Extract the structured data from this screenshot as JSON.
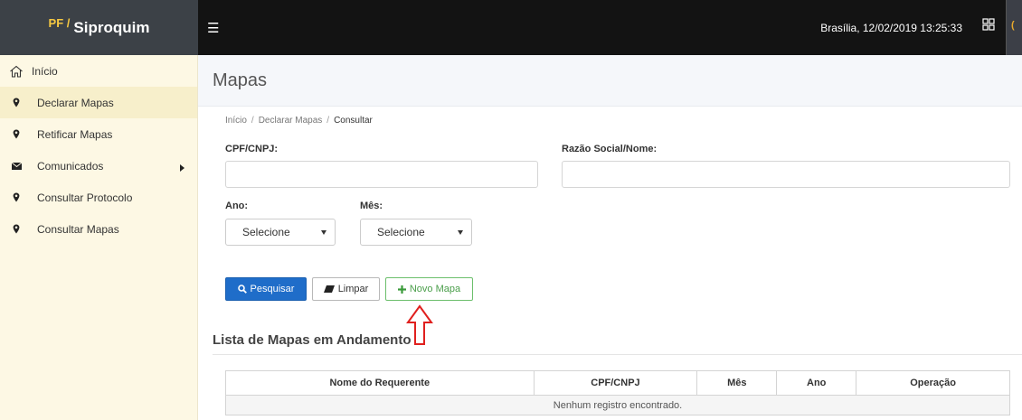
{
  "brand": {
    "prefix": "PF /",
    "name": "Siproquim"
  },
  "topbar": {
    "datetime": "Brasília, 12/02/2019 13:25:33",
    "edge_text": "("
  },
  "sidebar": {
    "items": [
      {
        "label": "Início",
        "icon": "home-icon"
      },
      {
        "label": "Declarar Mapas",
        "icon": "map-marker-icon"
      },
      {
        "label": "Retificar Mapas",
        "icon": "map-marker-icon"
      },
      {
        "label": "Comunicados",
        "icon": "envelope-icon"
      },
      {
        "label": "Consultar Protocolo",
        "icon": "map-marker-icon"
      },
      {
        "label": "Consultar Mapas",
        "icon": "map-marker-icon"
      }
    ]
  },
  "page": {
    "title": "Mapas"
  },
  "breadcrumb": {
    "items": [
      "Início",
      "Declarar Mapas",
      "Consultar"
    ]
  },
  "form": {
    "cpf_label": "CPF/CNPJ:",
    "cpf_value": "",
    "razao_label": "Razão Social/Nome:",
    "razao_value": "",
    "ano_label": "Ano:",
    "ano_selected": "Selecione",
    "mes_label": "Mês:",
    "mes_selected": "Selecione"
  },
  "buttons": {
    "search": "Pesquisar",
    "clear": "Limpar",
    "new": "Novo Mapa"
  },
  "list": {
    "title": "Lista de Mapas em Andamento",
    "columns": [
      "Nome do Requerente",
      "CPF/CNPJ",
      "Mês",
      "Ano",
      "Operação"
    ],
    "empty_message": "Nenhum registro encontrado."
  },
  "colors": {
    "primary": "#1f6dc9",
    "success": "#4a9e4a",
    "sidebar_bg": "#fdf8e4",
    "topbar_bg": "#131313",
    "annotation": "#e0201e"
  }
}
